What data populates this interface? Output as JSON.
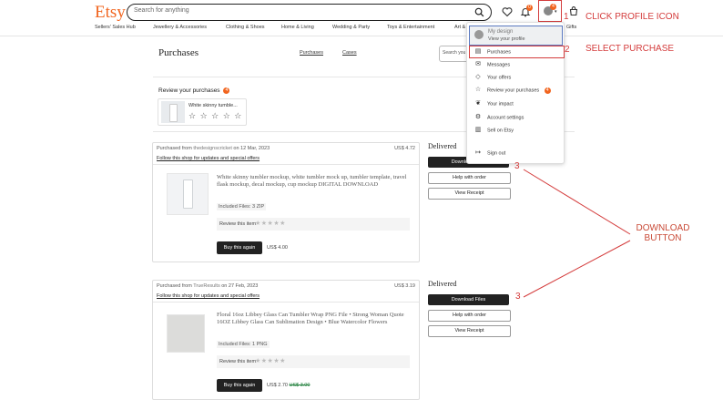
{
  "header": {
    "logo": "Etsy",
    "search_placeholder": "Search for anything",
    "notif_count": "0",
    "profile_badge": "4"
  },
  "categories": [
    "Sellers' Sales Hub",
    "Jewellery & Accessories",
    "Clothing & Shoes",
    "Home & Living",
    "Wedding & Party",
    "Toys & Entertainment",
    "Art &",
    "Gifts"
  ],
  "page": {
    "title": "Purchases",
    "tabs": [
      "Purchases",
      "Cases"
    ],
    "search_placeholder": "Search you"
  },
  "review_section": {
    "title": "Review your purchases",
    "count": "4",
    "item_title": "White skinny tumble...",
    "stars": "☆ ☆ ☆ ☆ ☆"
  },
  "orders": [
    {
      "purchased_from": "Purchased from",
      "shop": "thedesignscricket",
      "date": "on 12 Mar, 2023",
      "total": "US$ 4.72",
      "follow": "Follow this shop for updates and special offers",
      "title": "White skinny tumbler mockup, white tumbler mock up, tumbler template, travel flask mockup, decal mockup, cup mockup DIGITAL DOWNLOAD",
      "files": "Included Files: 3 ZIP",
      "review_label": "Review this item",
      "review_stars": "★★★★★",
      "buy_label": "Buy this again",
      "price": "US$ 4.00",
      "old_price": "",
      "status": "Delivered",
      "download": "Download Files",
      "help": "Help with order",
      "receipt": "View Receipt"
    },
    {
      "purchased_from": "Purchased from",
      "shop": "TrueResults",
      "date": "on 27 Feb, 2023",
      "total": "US$ 3.19",
      "follow": "Follow this shop for updates and special offers",
      "title": "Floral 16oz Libbey Glass Can Tumbler Wrap PNG File • Strong Woman Quote 16OZ Libbey Glass Can Sublimation Design • Blue Watercolor Flowers",
      "files": "Included Files: 1 PNG",
      "review_label": "Review this item",
      "review_stars": "★★★★★",
      "buy_label": "Buy this again",
      "price": "US$ 2.70",
      "old_price": "US$ 3.00",
      "status": "Delivered",
      "download": "Download Files",
      "help": "Help with order",
      "receipt": "View Receipt"
    }
  ],
  "dropdown": {
    "name": "My design",
    "view_profile": "View your profile",
    "items": [
      "Purchases",
      "Messages",
      "Your offers",
      "Review your purchases",
      "Your impact",
      "Account settings",
      "Sell on Etsy",
      "Sign out"
    ],
    "review_count": "4"
  },
  "annotations": {
    "step1_num": "1",
    "step1_text": "CLICK PROFILE ICON",
    "step2_num": "2",
    "step2_text": "SELECT PURCHASE",
    "step3a": "3",
    "step3b": "3",
    "download_line1": "DOWNLOAD",
    "download_line2": "BUTTON",
    "color": "#d43c3c"
  }
}
